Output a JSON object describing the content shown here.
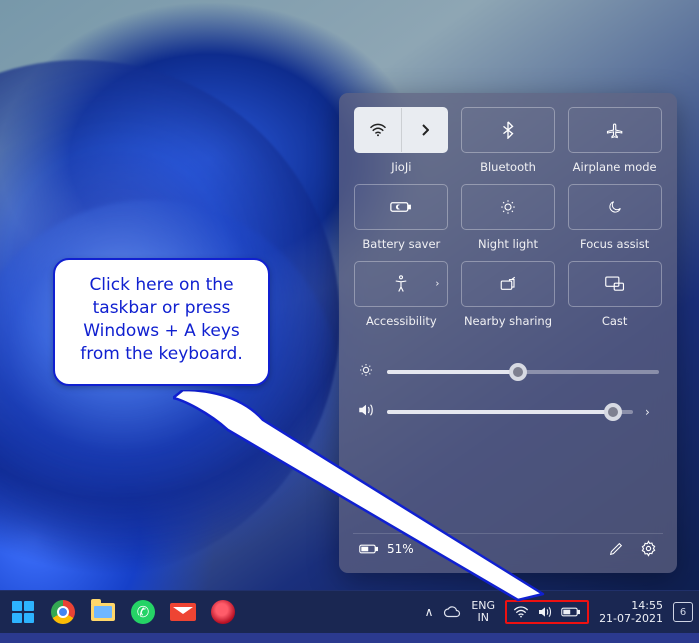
{
  "callout": {
    "text": "Click here on the taskbar or press Windows + A keys from the keyboard."
  },
  "quick_settings": {
    "tiles": [
      {
        "label": "JioJi",
        "icon": "wifi-icon",
        "active": true,
        "has_arrow": true,
        "split": true
      },
      {
        "label": "Bluetooth",
        "icon": "bluetooth-icon",
        "active": false,
        "has_arrow": false
      },
      {
        "label": "Airplane mode",
        "icon": "airplane-icon",
        "active": false,
        "has_arrow": false
      },
      {
        "label": "Battery saver",
        "icon": "battery-saver-icon",
        "active": false,
        "has_arrow": false
      },
      {
        "label": "Night light",
        "icon": "night-light-icon",
        "active": false,
        "has_arrow": false
      },
      {
        "label": "Focus assist",
        "icon": "focus-assist-icon",
        "active": false,
        "has_arrow": false
      },
      {
        "label": "Accessibility",
        "icon": "accessibility-icon",
        "active": false,
        "has_arrow": true
      },
      {
        "label": "Nearby sharing",
        "icon": "nearby-share-icon",
        "active": false,
        "has_arrow": false
      },
      {
        "label": "Cast",
        "icon": "cast-icon",
        "active": false,
        "has_arrow": false
      }
    ],
    "brightness": {
      "percent": 48
    },
    "volume": {
      "percent": 92,
      "has_expand": true
    },
    "battery_status": "51%"
  },
  "taskbar": {
    "tray_chevron": "^",
    "cloud_icon": "cloud-icon",
    "language_top": "ENG",
    "language_bottom": "IN",
    "sys_icons": [
      "wifi-icon",
      "volume-icon",
      "battery-icon"
    ],
    "time": "14:55",
    "date": "21-07-2021",
    "notification_count": "6"
  }
}
